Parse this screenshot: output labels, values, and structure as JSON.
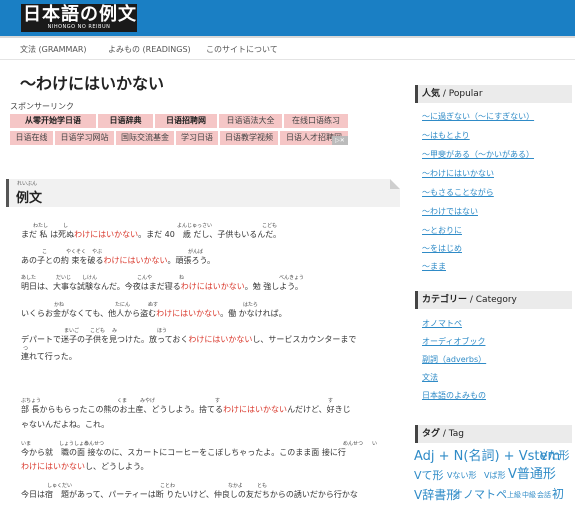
{
  "site": {
    "logo_title": "日本語の例文",
    "logo_subtitle": "NIHONGO NO REIBUN"
  },
  "nav": {
    "items": [
      "文法 (GRAMMAR)",
      "よみもの (READINGS)",
      "このサイトについて"
    ]
  },
  "page": {
    "title": "～わけにはいかない"
  },
  "sponsor": {
    "label": "スポンサーリンク",
    "row1": [
      "从零开始学日语",
      "日语辞典",
      "日语招聘网",
      "日语语法大全",
      "在线口语练习"
    ],
    "row2": [
      "日语在线",
      "日语学习网站",
      "国际交流基金",
      "学习日语",
      "日语教学视频",
      "日语人才招聘网"
    ]
  },
  "section": {
    "title": "例文",
    "ruby": "れいぶん"
  },
  "examples": {
    "s1": {
      "rt_a": "わたし",
      "rt_b": "し",
      "rt_c": "よんじゅっさい",
      "rt_d": "こども",
      "pre": "まだ 私 は死ぬ",
      "red": "わけにはいかない",
      "post": "。まだ 40　歳 だし、子供もいるんだ。"
    },
    "s2": {
      "rt_a": "こ",
      "rt_b": "やくそく",
      "rt_c": "やぶ",
      "rt_d": "がんば",
      "pre": "あの子との約 束を破る",
      "red": "わけにはいかない",
      "post": "。頑張ろう。"
    },
    "s3": {
      "rt_a": "あした",
      "rt_b": "だいじ",
      "rt_c": "しけん",
      "rt_d": "こんや",
      "rt_e": "ね",
      "rt_f": "べんきょう",
      "pre": "明日は、大事な試験なんだ。今夜はまだ寝る",
      "red": "わけにはいかない",
      "post": "。勉 強しよう。"
    },
    "s4": {
      "rt_a": "かね",
      "rt_b": "たにん",
      "rt_c": "ぬす",
      "rt_d": "はたら",
      "pre": "いくらお金がなくても、他人から盗む",
      "red": "わけにはいかない",
      "post": "。働 かなければ。"
    },
    "s5": {
      "rt_a": "まいご",
      "rt_b": "こども",
      "rt_c": "み",
      "rt_d": "ほう",
      "rt_e": "つ",
      "pre": "デパートで迷子の子供を見つけた。放っておく",
      "red": "わけにはいかない",
      "post": "し、サービスカウンターまで",
      "line2": "連れて行った。"
    },
    "s6": {
      "rt_a": "ぶちょう",
      "rt_b": "くま",
      "rt_c": "みやげ",
      "rt_d": "す",
      "rt_e": "す",
      "pre": "部 長からもらったこの熊のお土産、どうしよう。捨てる",
      "red": "わけにはいかない",
      "post": "んだけど、好きじ",
      "line2": "ゃないんだよね。これ。"
    },
    "s7": {
      "rt_a": "いま",
      "rt_b": "しょうしょう",
      "rt_c": "めんせつ",
      "rt_d": "めんせつ",
      "rt_e": "い",
      "line1": "今から就　職の面 接なのに、スカートにコーヒーをこぼしちゃったよ。このまま面 接に行",
      "red": "わけにはいかない",
      "post": "し、どうしよう。"
    },
    "s8": {
      "rt_a": "しゅくだい",
      "rt_b": "ことわ",
      "rt_c": "なかよ",
      "rt_d": "とも",
      "line1": "今日は宿　題があって、パーティーは断 りたいけど、仲良しの友だちからの誘いだから行かな"
    }
  },
  "sidebar": {
    "popular": {
      "title": "人気",
      "en": " / Popular",
      "items": [
        "～に過ぎない（～にすぎない）",
        "～はもとより",
        "～甲斐がある（～かいがある）",
        "～わけにはいかない",
        "～もさることながら",
        "～わけではない",
        "～とおりに",
        "～をはじめ",
        "～まま"
      ]
    },
    "category": {
      "title": "カテゴリー",
      "en": " / Category",
      "items": [
        "オノマトペ",
        "オーディオブック",
        "副詞（adverbs）",
        "文法",
        "日本語のよみもの"
      ]
    },
    "tags": {
      "title": "タグ",
      "en": " / Tag",
      "items": [
        "Adj + N(名詞) + Vstem",
        "Vた形",
        "Vて形",
        "Vない形",
        "Vば形",
        "V普通形",
        "V辞書形",
        "オノマトペ",
        "上級",
        "中級",
        "会話",
        "初"
      ]
    }
  },
  "colors": {
    "header": "#1a7fc4",
    "accent_red": "#d9362a",
    "link": "#2f8bc7",
    "ad_bg": "#f5c6c6"
  }
}
